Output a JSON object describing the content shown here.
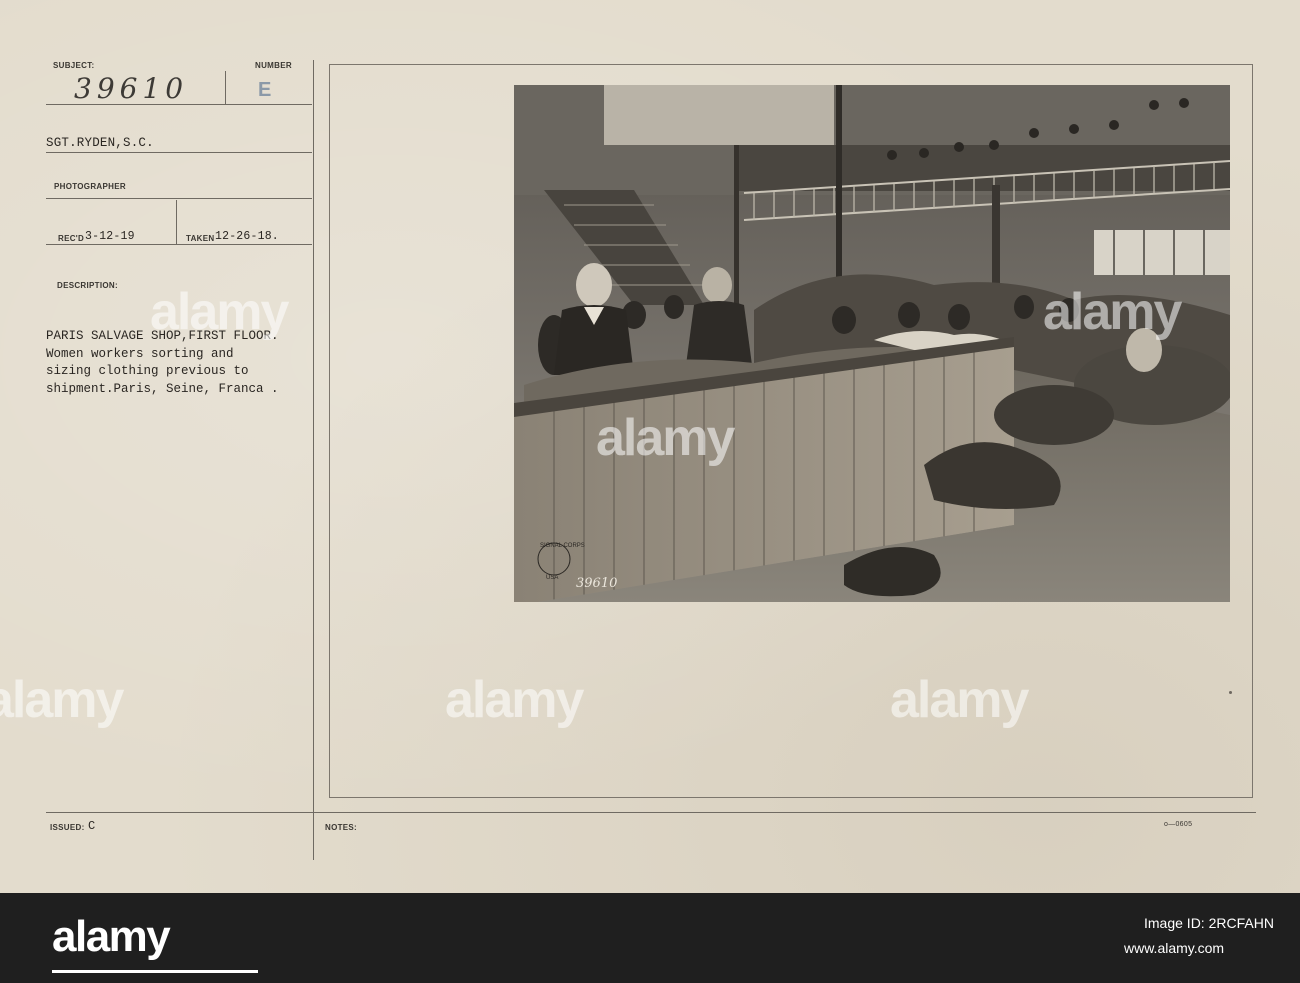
{
  "card": {
    "labels": {
      "subject": "SUBJECT:",
      "number": "NUMBER",
      "photographer": "PHOTOGRAPHER",
      "recd": "REC'D",
      "taken": "TAKEN",
      "description": "DESCRIPTION:",
      "issued": "ISSUED:",
      "notes": "NOTES:"
    },
    "subject_number": "39610",
    "number_letter": "E",
    "photographer_name": "SGT.RYDEN,S.C.",
    "recd_date": "3-12-19",
    "taken_date": "12-26-18.",
    "description_lines": [
      "PARIS SALVAGE SHOP,FIRST FLOOR.",
      "Women workers sorting and",
      "sizing clothing previous to",
      "shipment.Paris, Seine, Franca  ."
    ],
    "issued_value": "C",
    "form_code": "o—0605"
  },
  "photo": {
    "negative_number": "39610",
    "stamp_text_top": "SIGNAL CORPS",
    "stamp_text_bottom": "USA"
  },
  "watermarks": [
    "alamy",
    "alamy",
    "alamy",
    "alamy",
    "alamy",
    "alamy"
  ],
  "footer": {
    "logo_text": "alamy",
    "image_id_label": "Image ID: 2RCFAHN",
    "site_text": "www.alamy.com"
  },
  "colors": {
    "card_background": "#e3dccd",
    "footer_background": "#1f1f1f",
    "ink": "#2a2622",
    "stamp_blue": "#8b99a8"
  }
}
